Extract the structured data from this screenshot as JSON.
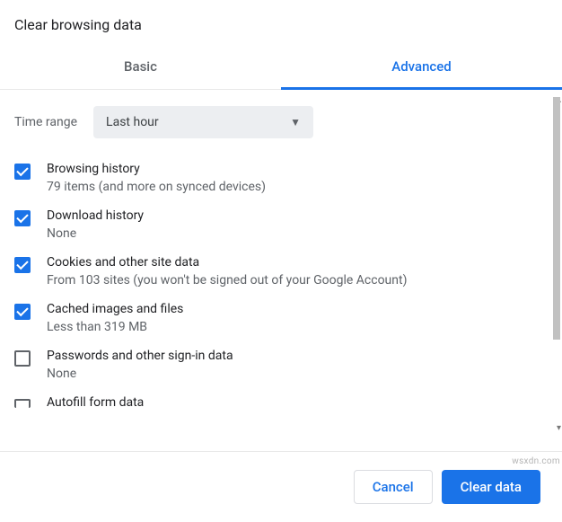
{
  "dialog": {
    "title": "Clear browsing data"
  },
  "tabs": {
    "basic": "Basic",
    "advanced": "Advanced"
  },
  "time_range": {
    "label": "Time range",
    "selected": "Last hour"
  },
  "items": [
    {
      "title": "Browsing history",
      "sub": "79 items (and more on synced devices)",
      "checked": true
    },
    {
      "title": "Download history",
      "sub": "None",
      "checked": true
    },
    {
      "title": "Cookies and other site data",
      "sub": "From 103 sites (you won't be signed out of your Google Account)",
      "checked": true
    },
    {
      "title": "Cached images and files",
      "sub": "Less than 319 MB",
      "checked": true
    },
    {
      "title": "Passwords and other sign-in data",
      "sub": "None",
      "checked": false
    },
    {
      "title": "Autofill form data",
      "sub": "",
      "checked": false
    }
  ],
  "footer": {
    "cancel": "Cancel",
    "clear": "Clear data"
  },
  "watermark": "wsxdn.com"
}
